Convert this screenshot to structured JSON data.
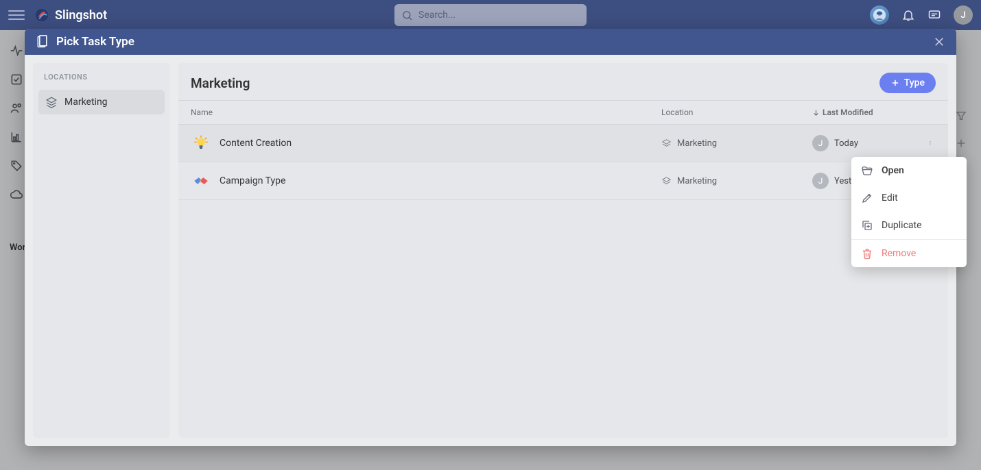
{
  "brand": {
    "name": "Slingshot"
  },
  "search": {
    "placeholder": "Search..."
  },
  "nav": {
    "avatar_initial": "J"
  },
  "left_label": "Wor",
  "modal": {
    "title": "Pick Task Type",
    "locations_title": "LOCATIONS",
    "locations": [
      {
        "label": "Marketing"
      }
    ],
    "content_title": "Marketing",
    "type_button": "Type",
    "columns": {
      "name": "Name",
      "location": "Location",
      "modified": "Last Modified"
    },
    "rows": [
      {
        "name": "Content Creation",
        "location": "Marketing",
        "modified": "Today",
        "avatar": "J",
        "icon": "bulb"
      },
      {
        "name": "Campaign Type",
        "location": "Marketing",
        "modified": "Yesterday",
        "avatar": "J",
        "icon": "handshake"
      }
    ]
  },
  "context_menu": {
    "open": "Open",
    "edit": "Edit",
    "duplicate": "Duplicate",
    "remove": "Remove"
  }
}
